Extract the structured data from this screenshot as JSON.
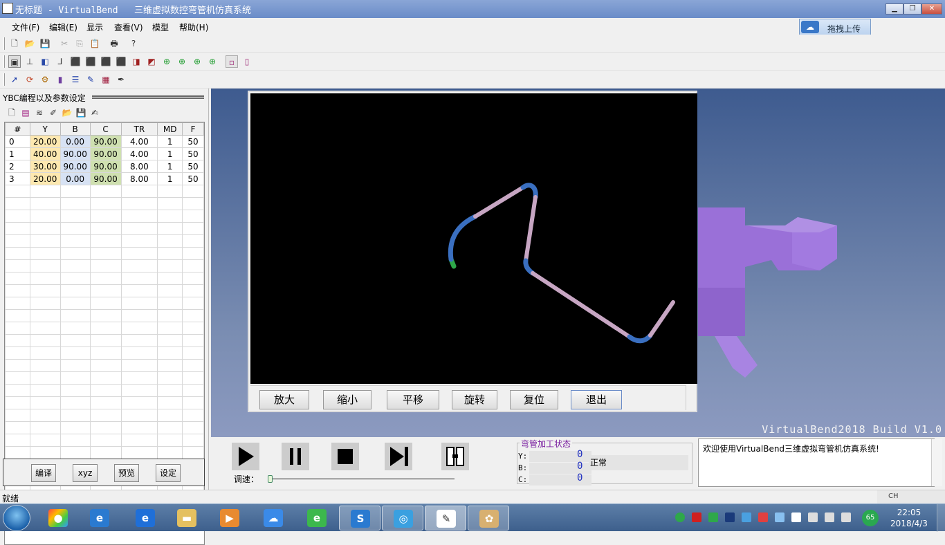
{
  "window": {
    "title": "无标题 - VirtualBend   三维虚拟数控弯管机仿真系统",
    "min": "▁",
    "max": "❐",
    "close": "✕"
  },
  "menu": [
    "文件(F)",
    "编辑(E)",
    "显示",
    "查看(V)",
    "模型",
    "帮助(H)"
  ],
  "cloud": {
    "label": "拖拽上传",
    "icon": "cloud-icon"
  },
  "panel": {
    "title": "YBC编程以及参数设定",
    "columns": [
      "#",
      "Y",
      "B",
      "C",
      "TR",
      "MD",
      "F"
    ],
    "rows": [
      [
        "0",
        "20.00",
        "0.00",
        "90.00",
        "4.00",
        "1",
        "50"
      ],
      [
        "1",
        "40.00",
        "90.00",
        "90.00",
        "4.00",
        "1",
        "50"
      ],
      [
        "2",
        "30.00",
        "90.00",
        "90.00",
        "8.00",
        "1",
        "50"
      ],
      [
        "3",
        "20.00",
        "0.00",
        "90.00",
        "8.00",
        "1",
        "50"
      ]
    ],
    "buttons": [
      "编译",
      "xyz",
      "预览",
      "设定"
    ]
  },
  "preview": {
    "buttons": [
      "放大",
      "缩小",
      "平移",
      "旋转",
      "复位",
      "退出"
    ]
  },
  "build_label": "VirtualBend2018 Build V1.0",
  "controls": {
    "speed_label": "调速：",
    "speed_level": 0.0
  },
  "status": {
    "title": "弯管加工状态",
    "labels": [
      "Y:",
      "B:",
      "C:"
    ],
    "values": [
      "0",
      "0",
      "0"
    ],
    "state": "正常"
  },
  "message": "欢迎使用VirtualBend三维虚拟弯管机仿真系统!",
  "statusbar": {
    "text": "就绪",
    "ime": "CH"
  },
  "clock": {
    "time": "22:05",
    "date": "2018/4/3"
  },
  "tray_badge": "65",
  "colors": {
    "tube_straight": "#c7a6c3",
    "tube_bend": "#3a6fc0",
    "tube_end": "#2ea84a",
    "machine": "#9a70d8"
  }
}
